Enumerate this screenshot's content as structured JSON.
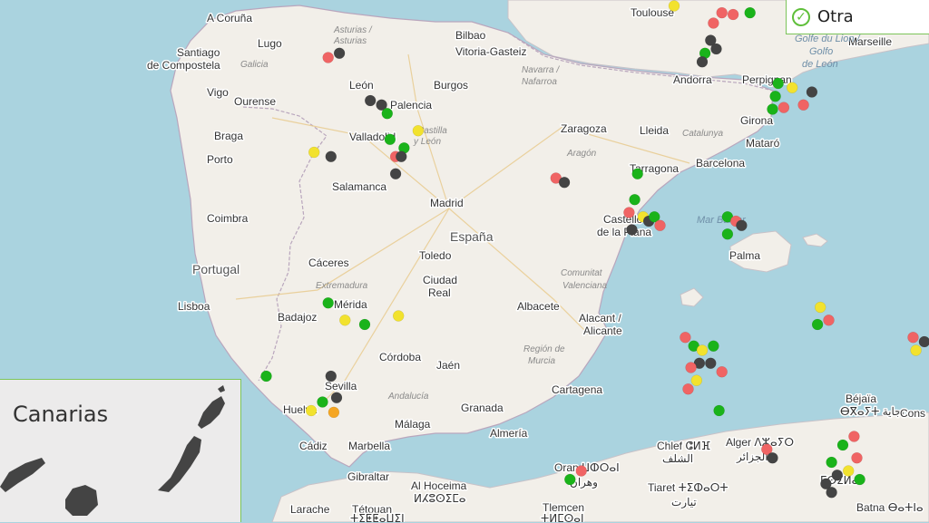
{
  "legend": {
    "label": "Otra",
    "icon": "check-circle-icon"
  },
  "inset": {
    "title": "Canarias"
  },
  "colors": {
    "green": "#1ab31a",
    "red": "#f06464",
    "yellow": "#f2e22e",
    "dark": "#444444",
    "orange": "#f5a623"
  },
  "labels": {
    "acoruna": "A Coruña",
    "lugo": "Lugo",
    "santiago1": "Santiago",
    "santiago2": "de Compostela",
    "galicia": "Galicia",
    "vigo": "Vigo",
    "ourense": "Ourense",
    "braga": "Braga",
    "porto": "Porto",
    "coimbra": "Coimbra",
    "portugal": "Portugal",
    "lisboa": "Lisboa",
    "leon": "León",
    "asturias1": "Asturias /",
    "asturias2": "Asturias",
    "palencia": "Palencia",
    "burgos": "Burgos",
    "bilbao": "Bilbao",
    "vitoria": "Vitoria-Gasteiz",
    "navarra1": "Navarra /",
    "navarra2": "Nafarroa",
    "castilla1": "Castilla",
    "castilla2": "y León",
    "valladolid": "Valladolid",
    "salamanca": "Salamanca",
    "madrid": "Madrid",
    "espana": "España",
    "toledo": "Toledo",
    "caceres": "Cáceres",
    "extremadura": "Extremadura",
    "merida": "Mérida",
    "badajoz": "Badajoz",
    "ciudadreal1": "Ciudad",
    "ciudadreal2": "Real",
    "cordoba": "Córdoba",
    "jaen": "Jaén",
    "andalucia": "Andalucía",
    "sevilla": "Sevilla",
    "huelva": "Huelva",
    "granada": "Granada",
    "malaga": "Málaga",
    "almeria": "Almería",
    "cadiz": "Cádiz",
    "marbella": "Marbella",
    "gibraltar": "Gibraltar",
    "zaragoza": "Zaragoza",
    "aragon": "Aragón",
    "lleida": "Lleida",
    "catalunya": "Catalunya",
    "tarragona": "Tarragona",
    "barcelona": "Barcelona",
    "mataro": "Mataró",
    "girona": "Girona",
    "perpignan": "Perpignan",
    "andorra": "Andorra",
    "toulouse": "Toulouse",
    "marseille": "Marseille",
    "golfo1": "Golfe du Lion /",
    "golfo2": "Golfo",
    "golfo3": "de León",
    "castellon1": "Castelló",
    "castellon2": "de la Plana",
    "comunitat1": "Comunitat",
    "comunitat2": "Valenciana",
    "albacete": "Albacete",
    "alicante1": "Alacant /",
    "alicante2": "Alicante",
    "region1": "Región de",
    "region2": "Murcia",
    "cartagena": "Cartagena",
    "marbalear": "Mar Balear",
    "palma": "Palma",
    "bejaia": "Béjaïa",
    "bejaia_ar": "ⴱⴳⴰⵢⵜ بجاية",
    "alger": "Alger ⴷⵣⴰⵢⵔ",
    "alger_ar": "الجزائر",
    "chlef": "Chlef ⵛⵍⴼ",
    "chlef_ar": "الشلف",
    "oran": "Oran ⵡⵀⵔⴰⵏ",
    "oran_ar": "وهران",
    "tiaret": "Tiaret ⵜⵉⵀⴰⵔⵜ",
    "tiaret_ar": "تيارت",
    "tlemcen": "Tlemcen",
    "tlemcen_ar": "ⵜⵍⵎⵙⴰⵏ",
    "alhoceima": "Al Hoceima",
    "alhoceima_ar": "ⵍⵃⵓⵙⵉⵎⴰ",
    "larache": "Larache",
    "tetouan": "Tétouan",
    "tetouan_ar": "ⵜⵉⵟⵟⴰⵡⵉⵏ",
    "msila": "ⵎⵙⵉⵍⴰ",
    "batna": "Batna ⴱⴰⵜⵏⴰ",
    "cons": "Cons"
  },
  "markers": [
    {
      "lon": -3.7,
      "lat": 43.45,
      "c": "red"
    },
    {
      "lon": -3.45,
      "lat": 43.42,
      "c": "green"
    },
    {
      "lon": -2.7,
      "lat": 43.45,
      "c": "green"
    },
    {
      "lon": -2.25,
      "lat": 43.43,
      "c": "yellow"
    },
    {
      "lon": -3.4,
      "lat": 43.1,
      "c": "green"
    },
    {
      "lon": -3.15,
      "lat": 43.2,
      "c": "green"
    },
    {
      "lon": -0.55,
      "lat": 43.35,
      "c": "green"
    },
    {
      "lon": -0.35,
      "lat": 43.3,
      "c": "green"
    },
    {
      "lon": -0.2,
      "lat": 43.35,
      "c": "yellow"
    },
    {
      "lon": 0.05,
      "lat": 43.4,
      "c": "green"
    },
    {
      "lon": 0.2,
      "lat": 43.35,
      "c": "yellow"
    },
    {
      "lon": 0.3,
      "lat": 43.3,
      "c": "green"
    },
    {
      "lon": 0.55,
      "lat": 43.3,
      "c": "green"
    },
    {
      "lon": 0.45,
      "lat": 43.2,
      "c": "green"
    },
    {
      "lon": 0.1,
      "lat": 43.22,
      "c": "green"
    },
    {
      "lon": -0.1,
      "lat": 43.0,
      "c": "yellow"
    },
    {
      "lon": 0.3,
      "lat": 42.7,
      "c": "yellow"
    },
    {
      "lon": 1.2,
      "lat": 42.8,
      "c": "green"
    },
    {
      "lon": 1.15,
      "lat": 42.62,
      "c": "red"
    },
    {
      "lon": 1.35,
      "lat": 42.6,
      "c": "red"
    },
    {
      "lon": 1.0,
      "lat": 42.5,
      "c": "red"
    },
    {
      "lon": 1.65,
      "lat": 42.62,
      "c": "green"
    },
    {
      "lon": 0.95,
      "lat": 42.3,
      "c": "dark"
    },
    {
      "lon": 0.85,
      "lat": 42.15,
      "c": "green"
    },
    {
      "lon": 1.05,
      "lat": 42.2,
      "c": "dark"
    },
    {
      "lon": 0.8,
      "lat": 42.05,
      "c": "dark"
    },
    {
      "lon": 2.15,
      "lat": 41.8,
      "c": "green"
    },
    {
      "lon": 2.4,
      "lat": 41.75,
      "c": "yellow"
    },
    {
      "lon": 2.75,
      "lat": 41.7,
      "c": "dark"
    },
    {
      "lon": 2.6,
      "lat": 41.55,
      "c": "red"
    },
    {
      "lon": 2.25,
      "lat": 41.52,
      "c": "red"
    },
    {
      "lon": 2.1,
      "lat": 41.65,
      "c": "green"
    },
    {
      "lon": 2.05,
      "lat": 41.5,
      "c": "green"
    },
    {
      "lon": -5.1,
      "lat": 41.6,
      "c": "dark"
    },
    {
      "lon": -4.9,
      "lat": 41.55,
      "c": "dark"
    },
    {
      "lon": -4.8,
      "lat": 41.45,
      "c": "green"
    },
    {
      "lon": -6.1,
      "lat": 41.0,
      "c": "yellow"
    },
    {
      "lon": -5.8,
      "lat": 40.95,
      "c": "dark"
    },
    {
      "lon": -4.75,
      "lat": 41.15,
      "c": "green"
    },
    {
      "lon": -4.5,
      "lat": 41.05,
      "c": "green"
    },
    {
      "lon": -4.25,
      "lat": 41.25,
      "c": "yellow"
    },
    {
      "lon": -4.65,
      "lat": 40.95,
      "c": "red"
    },
    {
      "lon": -4.55,
      "lat": 40.95,
      "c": "dark"
    },
    {
      "lon": -4.65,
      "lat": 40.75,
      "c": "dark"
    },
    {
      "lon": -1.8,
      "lat": 40.7,
      "c": "red"
    },
    {
      "lon": -1.65,
      "lat": 40.65,
      "c": "dark"
    },
    {
      "lon": -0.35,
      "lat": 40.75,
      "c": "green"
    },
    {
      "lon": -0.4,
      "lat": 40.45,
      "c": "green"
    },
    {
      "lon": -0.5,
      "lat": 40.3,
      "c": "red"
    },
    {
      "lon": -0.25,
      "lat": 40.25,
      "c": "yellow"
    },
    {
      "lon": -0.15,
      "lat": 40.2,
      "c": "dark"
    },
    {
      "lon": -0.05,
      "lat": 40.25,
      "c": "green"
    },
    {
      "lon": 0.05,
      "lat": 40.15,
      "c": "red"
    },
    {
      "lon": -0.45,
      "lat": 40.1,
      "c": "dark"
    },
    {
      "lon": 1.25,
      "lat": 40.25,
      "c": "green"
    },
    {
      "lon": 1.4,
      "lat": 40.2,
      "c": "red"
    },
    {
      "lon": 1.5,
      "lat": 40.15,
      "c": "dark"
    },
    {
      "lon": 1.25,
      "lat": 40.05,
      "c": "green"
    },
    {
      "lon": -5.85,
      "lat": 39.25,
      "c": "green"
    },
    {
      "lon": -5.55,
      "lat": 39.05,
      "c": "yellow"
    },
    {
      "lon": -5.2,
      "lat": 39.0,
      "c": "green"
    },
    {
      "lon": -4.6,
      "lat": 39.1,
      "c": "yellow"
    },
    {
      "lon": -6.95,
      "lat": 38.4,
      "c": "green"
    },
    {
      "lon": -6.15,
      "lat": 38.0,
      "c": "yellow"
    },
    {
      "lon": -5.95,
      "lat": 38.1,
      "c": "green"
    },
    {
      "lon": -5.75,
      "lat": 37.98,
      "c": "orange"
    },
    {
      "lon": -5.7,
      "lat": 38.15,
      "c": "dark"
    },
    {
      "lon": -5.8,
      "lat": 38.4,
      "c": "dark"
    },
    {
      "lon": 0.5,
      "lat": 38.85,
      "c": "red"
    },
    {
      "lon": 0.65,
      "lat": 38.75,
      "c": "green"
    },
    {
      "lon": 0.8,
      "lat": 38.7,
      "c": "yellow"
    },
    {
      "lon": 1.0,
      "lat": 38.75,
      "c": "green"
    },
    {
      "lon": 0.75,
      "lat": 38.55,
      "c": "dark"
    },
    {
      "lon": 0.6,
      "lat": 38.5,
      "c": "red"
    },
    {
      "lon": 0.95,
      "lat": 38.55,
      "c": "dark"
    },
    {
      "lon": 1.15,
      "lat": 38.45,
      "c": "red"
    },
    {
      "lon": 0.7,
      "lat": 38.35,
      "c": "yellow"
    },
    {
      "lon": 0.55,
      "lat": 38.25,
      "c": "red"
    },
    {
      "lon": 2.9,
      "lat": 39.2,
      "c": "yellow"
    },
    {
      "lon": 3.05,
      "lat": 39.05,
      "c": "red"
    },
    {
      "lon": 2.85,
      "lat": 39.0,
      "c": "green"
    },
    {
      "lon": 1.1,
      "lat": 38.0,
      "c": "green"
    },
    {
      "lon": 1.95,
      "lat": 37.55,
      "c": "red"
    },
    {
      "lon": 2.05,
      "lat": 37.45,
      "c": "dark"
    },
    {
      "lon": 4.55,
      "lat": 38.85,
      "c": "red"
    },
    {
      "lon": 4.75,
      "lat": 38.8,
      "c": "dark"
    },
    {
      "lon": 4.6,
      "lat": 38.7,
      "c": "yellow"
    },
    {
      "lon": -1.35,
      "lat": 37.3,
      "c": "red"
    },
    {
      "lon": -1.55,
      "lat": 37.2,
      "c": "green"
    },
    {
      "lon": 3.5,
      "lat": 37.7,
      "c": "red"
    },
    {
      "lon": 3.3,
      "lat": 37.6,
      "c": "green"
    },
    {
      "lon": 3.55,
      "lat": 37.45,
      "c": "red"
    },
    {
      "lon": 3.1,
      "lat": 37.4,
      "c": "green"
    },
    {
      "lon": 3.4,
      "lat": 37.3,
      "c": "yellow"
    },
    {
      "lon": 3.2,
      "lat": 37.25,
      "c": "dark"
    },
    {
      "lon": 3.6,
      "lat": 37.2,
      "c": "green"
    },
    {
      "lon": 3.0,
      "lat": 37.15,
      "c": "dark"
    },
    {
      "lon": 3.1,
      "lat": 37.05,
      "c": "dark"
    },
    {
      "lon": 0.4,
      "lat": 36.3,
      "c": "red"
    },
    {
      "lon": 0.5,
      "lat": 36.2,
      "c": "yellow"
    },
    {
      "lon": 0.45,
      "lat": 36.15,
      "c": "green"
    },
    {
      "lon": 5.0,
      "lat": 42.85,
      "c": "red"
    },
    {
      "lon": 4.9,
      "lat": 42.7,
      "c": "dark"
    },
    {
      "lon": 4.8,
      "lat": 42.6,
      "c": "orange"
    },
    {
      "lon": 4.95,
      "lat": 42.45,
      "c": "red"
    },
    {
      "lon": 5.1,
      "lat": 42.4,
      "c": "green"
    },
    {
      "lon": 5.35,
      "lat": 42.55,
      "c": "dark"
    },
    {
      "lon": 5.3,
      "lat": 42.3,
      "c": "dark"
    },
    {
      "lon": 5.45,
      "lat": 42.35,
      "c": "yellow"
    },
    {
      "lon": 6.45,
      "lat": 42.0,
      "c": "red"
    },
    {
      "lon": 6.7,
      "lat": 41.95,
      "c": "orange"
    },
    {
      "lon": 6.8,
      "lat": 41.8,
      "c": "dark"
    },
    {
      "lon": 6.05,
      "lat": 41.65,
      "c": "red"
    },
    {
      "lon": 5.7,
      "lat": 41.4,
      "c": "red"
    },
    {
      "lon": 5.55,
      "lat": 41.2,
      "c": "yellow"
    },
    {
      "lon": 7.95,
      "lat": 42.95,
      "c": "red"
    },
    {
      "lon": 8.1,
      "lat": 42.8,
      "c": "dark"
    },
    {
      "lon": 8.25,
      "lat": 42.7,
      "c": "yellow"
    },
    {
      "lon": 9.2,
      "lat": 42.45,
      "c": "red"
    },
    {
      "lon": 9.15,
      "lat": 42.3,
      "c": "orange"
    },
    {
      "lon": 9.05,
      "lat": 42.25,
      "c": "dark"
    },
    {
      "lon": 6.4,
      "lat": 39.0,
      "c": "red"
    },
    {
      "lon": 6.55,
      "lat": 38.95,
      "c": "dark"
    },
    {
      "lon": -5.85,
      "lat": 42.1,
      "c": "red"
    },
    {
      "lon": -5.65,
      "lat": 42.15,
      "c": "dark"
    }
  ]
}
